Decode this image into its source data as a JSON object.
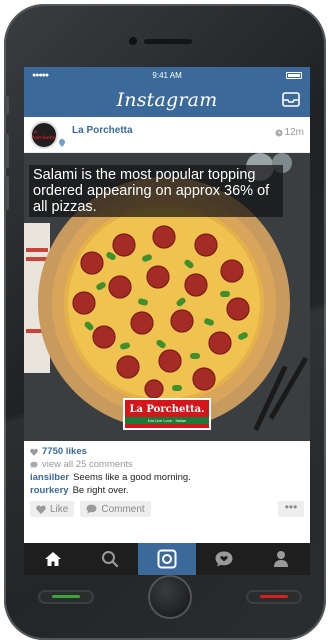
{
  "status_bar": {
    "signal": "●●●●●",
    "time": "9:41 AM"
  },
  "header": {
    "app_title": "Instagram"
  },
  "post": {
    "username": "La Porchetta",
    "avatar_text": "La Porchetta",
    "time_ago": "12m",
    "caption_overlay": "Salami is the most popular topping ordered appearing on approx 36% of all pizzas.",
    "badge_name": "La Porchetta.",
    "badge_tagline": "Eat Live Love · Italian",
    "likes": "7750 likes",
    "view_comments": "view all 25 comments",
    "comments": [
      {
        "user": "iansilber",
        "text": "Seems like a good morning."
      },
      {
        "user": "rourkery",
        "text": "Be right over."
      }
    ],
    "actions": {
      "like": "Like",
      "comment": "Comment",
      "more": "•••"
    }
  },
  "tabs": [
    {
      "name": "home-icon"
    },
    {
      "name": "search-icon"
    },
    {
      "name": "camera-icon"
    },
    {
      "name": "activity-icon"
    },
    {
      "name": "profile-icon"
    }
  ],
  "colors": {
    "brand": "#3b6a9a",
    "tabbar": "#1e1e1e",
    "badge_red": "#d3161b",
    "badge_green": "#1b7a36",
    "indicator_green": "#3aa63a",
    "indicator_red": "#d42020"
  }
}
